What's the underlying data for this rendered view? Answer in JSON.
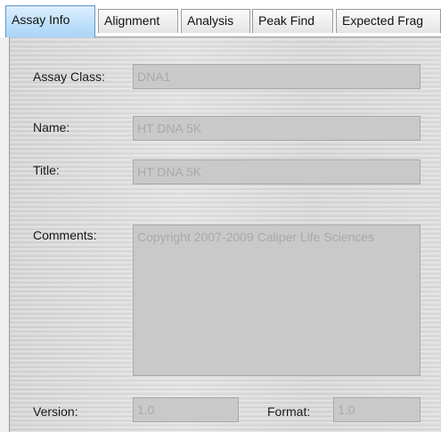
{
  "tabs": [
    {
      "label": "Assay Info",
      "active": true
    },
    {
      "label": "Alignment",
      "active": false
    },
    {
      "label": "Analysis",
      "active": false
    },
    {
      "label": "Peak Find",
      "active": false
    },
    {
      "label": "Expected Frag",
      "active": false
    }
  ],
  "form": {
    "assay_class_label": "Assay Class:",
    "assay_class_value": "DNA1",
    "name_label": "Name:",
    "name_value": "HT DNA 5K",
    "title_label": "Title:",
    "title_value": "HT DNA 5K",
    "comments_label": "Comments:",
    "comments_value": "Copyright 2007-2009  Caliper Life Sciences",
    "version_label": "Version:",
    "version_value": "1.0",
    "format_label": "Format:",
    "format_value": "1.0"
  },
  "colors": {
    "active_tab": "#a9d4f7",
    "panel_background": "#dcdcdc",
    "field_background": "#c9c9c9",
    "disabled_text": "#a9a9a9"
  }
}
